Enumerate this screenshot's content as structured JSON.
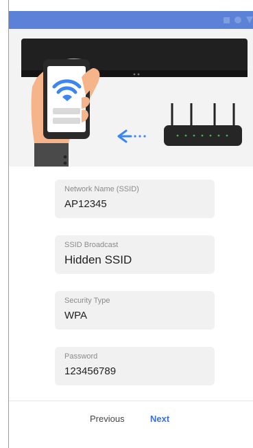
{
  "colors": {
    "status_bar": "#5b82d6",
    "accent": "#3d6fd6",
    "wifi_icon": "#3b86f0",
    "field_background": "#f1f1f1",
    "router_lights": "#4caf50"
  },
  "status_bar": {
    "icons": [
      "square-icon",
      "circle-icon",
      "triangle-icon"
    ]
  },
  "illustration": {
    "icons": [
      "tv-soundbar-icon",
      "hand-phone-icon",
      "wifi-icon",
      "arrow-left-icon",
      "router-icon"
    ]
  },
  "form": {
    "ssid": {
      "label": "Network Name (SSID)",
      "value": "AP12345"
    },
    "broadcast": {
      "label": "SSID Broadcast",
      "value": "Hidden SSID"
    },
    "security": {
      "label": "Security Type",
      "value": "WPA"
    },
    "password": {
      "label": "Password",
      "value": "123456789"
    }
  },
  "footer": {
    "previous_label": "Previous",
    "next_label": "Next"
  }
}
